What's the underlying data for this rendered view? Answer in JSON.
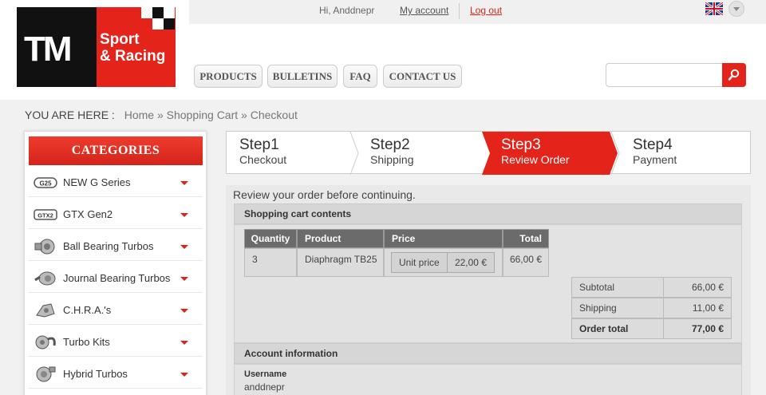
{
  "header": {
    "greeting": "Hi, Anddnepr",
    "my_account": "My account",
    "logout": "Log out",
    "logo_tm": "TM",
    "logo_line1": "Sport",
    "logo_line2": "& Racing",
    "nav": [
      "PRODUCTS",
      "BULLETINS",
      "FAQ",
      "CONTACT US"
    ],
    "search_placeholder": ""
  },
  "breadcrumb": {
    "label": "YOU ARE HERE :",
    "items": [
      "Home",
      "Shopping Cart",
      "Checkout"
    ],
    "separator": "»"
  },
  "sidebar": {
    "title": "CATEGORIES",
    "items": [
      {
        "label": "NEW G Series",
        "icon": "g25-badge-icon"
      },
      {
        "label": "GTX Gen2",
        "icon": "gtx2-badge-icon"
      },
      {
        "label": "Ball Bearing Turbos",
        "icon": "turbo-icon"
      },
      {
        "label": "Journal Bearing Turbos",
        "icon": "turbo-icon"
      },
      {
        "label": "C.H.R.A.'s",
        "icon": "chra-icon"
      },
      {
        "label": "Turbo Kits",
        "icon": "turbo-kit-icon"
      },
      {
        "label": "Hybrid Turbos",
        "icon": "hybrid-turbo-icon"
      }
    ],
    "badges": {
      "g25": "G25",
      "gtx2": "GTX2"
    }
  },
  "steps": [
    {
      "num": "Step1",
      "label": "Checkout"
    },
    {
      "num": "Step2",
      "label": "Shipping"
    },
    {
      "num": "Step3",
      "label": "Review Order"
    },
    {
      "num": "Step4",
      "label": "Payment"
    }
  ],
  "active_step": 3,
  "review": {
    "intro": "Review your order before continuing.",
    "cart_title": "Shopping cart contents",
    "columns": [
      "Quantity",
      "Product",
      "Price",
      "Total"
    ],
    "row": {
      "quantity": "3",
      "product": "Diaphragm TB25",
      "unit_label": "Unit price",
      "unit_price": "22,00 €",
      "total": "66,00 €"
    },
    "totals": [
      {
        "label": "Subtotal",
        "value": "66,00 €"
      },
      {
        "label": "Shipping",
        "value": "11,00 €"
      },
      {
        "label": "Order total",
        "value": "77,00 €"
      }
    ],
    "account_title": "Account information",
    "username_label": "Username",
    "username": "anddnepr"
  },
  "colors": {
    "brand_red": "#e4231a",
    "nav_text": "#555555",
    "header_dark": "#6b6b6b"
  }
}
